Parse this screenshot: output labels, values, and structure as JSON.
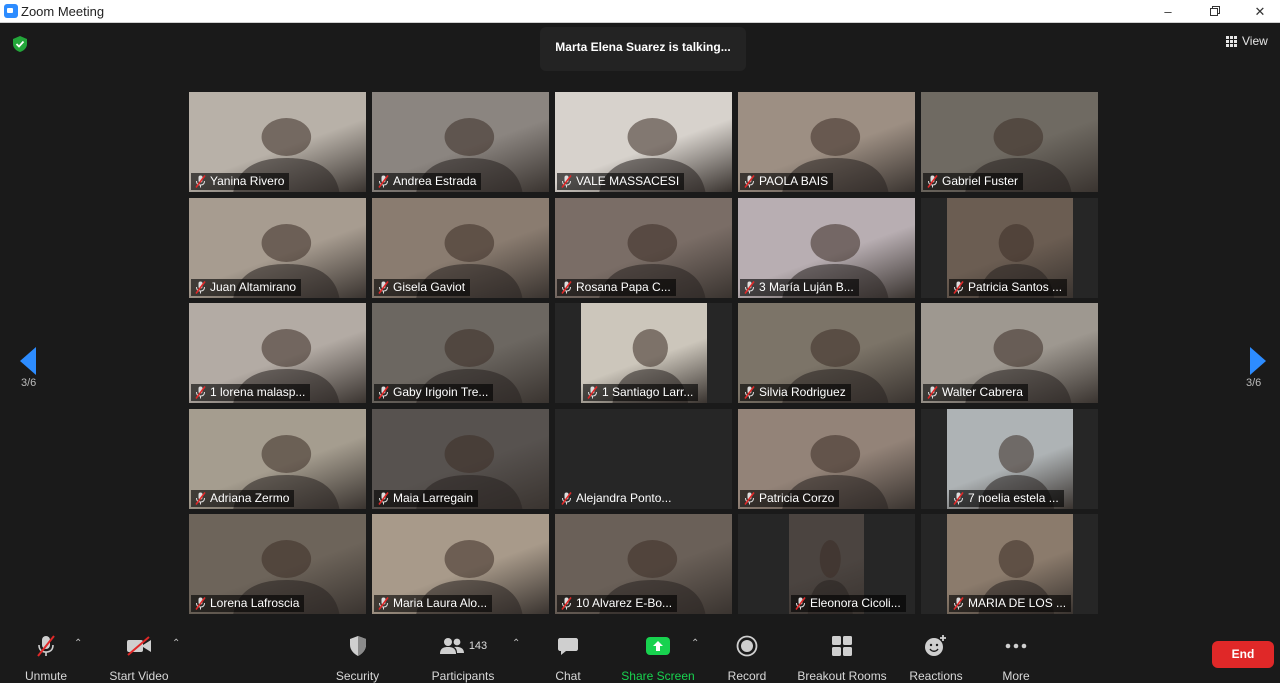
{
  "window": {
    "title": "Zoom Meeting"
  },
  "header": {
    "talking": "Marta Elena Suarez is talking...",
    "view_label": "View"
  },
  "nav": {
    "page_left": "3/6",
    "page_right": "3/6"
  },
  "participants": [
    {
      "name": "Yanina Rivero",
      "muted": true,
      "bg": "#b8b1a8"
    },
    {
      "name": "Andrea Estrada",
      "muted": true,
      "bg": "#8b8580"
    },
    {
      "name": "VALE MASSACESI",
      "muted": true,
      "bg": "#d7d2cc"
    },
    {
      "name": "PAOLA BAIS",
      "muted": true,
      "bg": "#9d8f83"
    },
    {
      "name": "Gabriel Fuster",
      "muted": true,
      "bg": "#6f6a62"
    },
    {
      "name": "Juan Altamirano",
      "muted": true,
      "bg": "#a79c90"
    },
    {
      "name": "Gisela Gaviot",
      "muted": true,
      "bg": "#8a7c70"
    },
    {
      "name": "Rosana Papa C...",
      "muted": true,
      "bg": "#7a6d66"
    },
    {
      "name": "3 María Luján B...",
      "muted": true,
      "bg": "#b8aeb2"
    },
    {
      "name": "Patricia Santos ...",
      "muted": true,
      "bg": "#6b5d52",
      "narrow": true
    },
    {
      "name": "1 lorena malasp...",
      "muted": true,
      "bg": "#b3aba4"
    },
    {
      "name": "Gaby Irigoin Tre...",
      "muted": true,
      "bg": "#6c6761"
    },
    {
      "name": "1 Santiago Larr...",
      "muted": true,
      "bg": "#ccc6bb",
      "narrow": true
    },
    {
      "name": "Silvia Rodriguez",
      "muted": true,
      "bg": "#7c7468"
    },
    {
      "name": "Walter Cabrera",
      "muted": true,
      "bg": "#9e9890"
    },
    {
      "name": "Adriana Zermo",
      "muted": true,
      "bg": "#a59d8f"
    },
    {
      "name": "Maia Larregain",
      "muted": true,
      "bg": "#57524f"
    },
    {
      "name": "Alejandra Ponto...",
      "muted": true,
      "bg": "#262626",
      "no_video": true
    },
    {
      "name": "Patricia Corzo",
      "muted": true,
      "bg": "#938378"
    },
    {
      "name": "7 noelia estela ...",
      "muted": true,
      "bg": "#aeb3b5",
      "narrow": true
    },
    {
      "name": "Lorena Lafroscia",
      "muted": true,
      "bg": "#6d645a"
    },
    {
      "name": "Maria Laura Alo...",
      "muted": true,
      "bg": "#a89a8a"
    },
    {
      "name": "10 Alvarez E-Bo...",
      "muted": true,
      "bg": "#6a6058"
    },
    {
      "name": "Eleonora Cicoli...",
      "muted": true,
      "bg": "#4b4440",
      "narrow": true,
      "narrow_w": 75
    },
    {
      "name": "MARIA DE LOS ...",
      "muted": true,
      "bg": "#8b7b6c",
      "narrow": true
    }
  ],
  "toolbar": {
    "unmute": "Unmute",
    "start_video": "Start Video",
    "security": "Security",
    "participants": "Participants",
    "participant_count": "143",
    "chat": "Chat",
    "share_screen": "Share Screen",
    "record": "Record",
    "breakout": "Breakout Rooms",
    "reactions": "Reactions",
    "more": "More",
    "end": "End"
  },
  "colors": {
    "accent": "#2D8CFF",
    "share_green": "#18d24f",
    "end_red": "#e02828",
    "mute_red": "#e02828"
  }
}
